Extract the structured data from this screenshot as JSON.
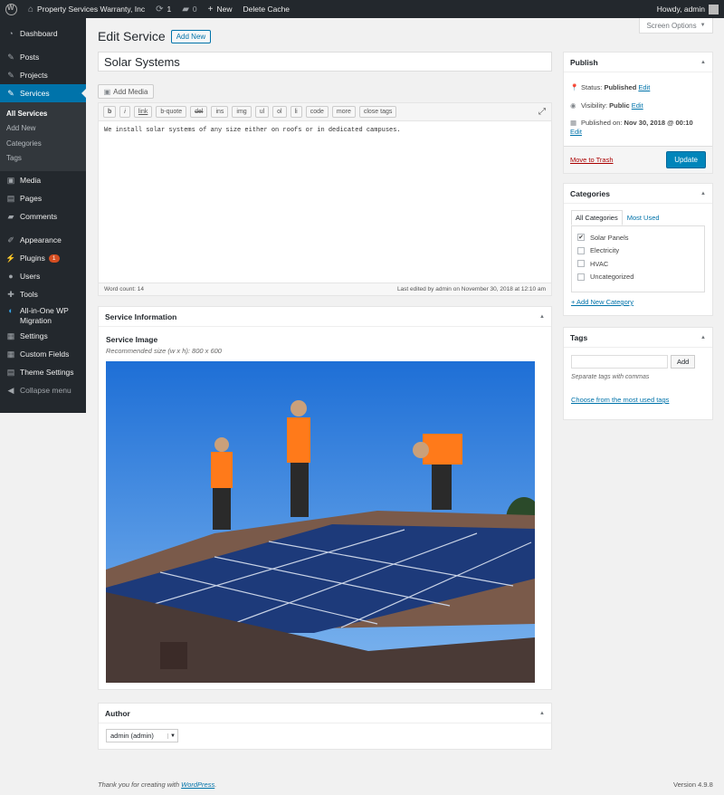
{
  "adminbar": {
    "site_name": "Property Services Warranty, Inc",
    "updates_count": "1",
    "comments_count": "0",
    "new_label": "New",
    "delete_cache": "Delete Cache",
    "howdy": "Howdy, admin"
  },
  "sidebar": {
    "dashboard": "Dashboard",
    "posts": "Posts",
    "projects": "Projects",
    "services": "Services",
    "sub": [
      "All Services",
      "Add New",
      "Categories",
      "Tags"
    ],
    "media": "Media",
    "pages": "Pages",
    "comments": "Comments",
    "appearance": "Appearance",
    "plugins": "Plugins",
    "plugins_badge": "1",
    "users": "Users",
    "tools": "Tools",
    "migration_line1": "All-in-One WP",
    "migration_line2": "Migration",
    "settings": "Settings",
    "custom_fields": "Custom Fields",
    "theme_settings": "Theme Settings",
    "collapse": "Collapse menu"
  },
  "screen_options": "Screen Options",
  "heading": {
    "title": "Edit Service",
    "add_new": "Add New"
  },
  "post": {
    "title": "Solar Systems",
    "content": "We install solar systems of any size either on roofs or in dedicated campuses.",
    "word_count": "Word count: 14",
    "last_edited": "Last edited by admin on November 30, 2018 at 12:10 am"
  },
  "editor": {
    "add_media": "Add Media",
    "buttons": [
      "b",
      "i",
      "link",
      "b-quote",
      "del",
      "ins",
      "img",
      "ul",
      "ol",
      "li",
      "code",
      "more",
      "close tags"
    ]
  },
  "service_info": {
    "heading": "Service Information",
    "image_label": "Service Image",
    "image_desc": "Recommended size (w x h): 800 x 600"
  },
  "author": {
    "heading": "Author",
    "selected": "admin (admin)"
  },
  "publish": {
    "heading": "Publish",
    "status_label": "Status:",
    "status_value": "Published",
    "visibility_label": "Visibility:",
    "visibility_value": "Public",
    "published_on_label": "Published on:",
    "published_on_value": "Nov 30, 2018 @ 00:10",
    "edit": "Edit",
    "move_to_trash": "Move to Trash",
    "update": "Update"
  },
  "categories": {
    "heading": "Categories",
    "tab_all": "All Categories",
    "tab_most_used": "Most Used",
    "items": [
      {
        "label": "Solar Panels",
        "checked": true
      },
      {
        "label": "Electricity",
        "checked": false
      },
      {
        "label": "HVAC",
        "checked": false
      },
      {
        "label": "Uncategorized",
        "checked": false
      }
    ],
    "add_new": "+ Add New Category"
  },
  "tags": {
    "heading": "Tags",
    "add": "Add",
    "hint": "Separate tags with commas",
    "choose": "Choose from the most used tags"
  },
  "footer": {
    "thanks_prefix": "Thank you for creating with ",
    "wordpress": "WordPress",
    "thanks_suffix": ".",
    "version": "Version 4.9.8"
  }
}
